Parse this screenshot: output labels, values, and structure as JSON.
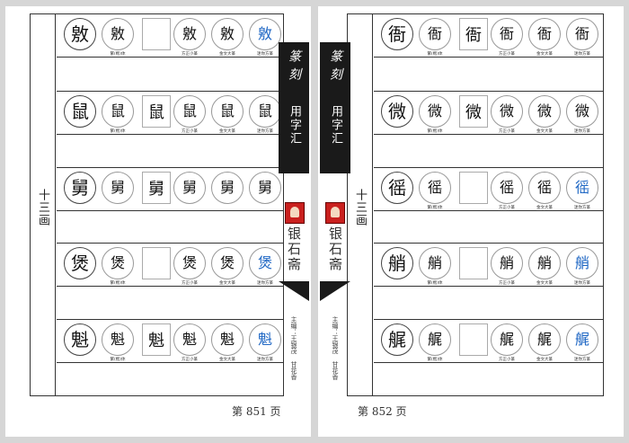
{
  "left": {
    "section": "十三画",
    "page_label": "第 851 页",
    "rows": [
      {
        "cells": [
          {
            "g": "敫",
            "k": "head"
          },
          {
            "g": "敫",
            "k": "c",
            "cap": "繁(楷)体"
          },
          {
            "g": "",
            "k": "sq"
          },
          {
            "g": "敫",
            "k": "c",
            "cap": "方正小篆"
          },
          {
            "g": "敫",
            "k": "c",
            "cap": "金文大篆"
          },
          {
            "g": "敫",
            "k": "c",
            "cap": "迷你方篆",
            "blue": true
          }
        ]
      },
      {
        "cells": [
          {
            "g": "鼠",
            "k": "head"
          },
          {
            "g": "鼠",
            "k": "c",
            "cap": "繁(楷)体"
          },
          {
            "g": "鼠",
            "k": "sq"
          },
          {
            "g": "鼠",
            "k": "c",
            "cap": "方正小篆"
          },
          {
            "g": "鼠",
            "k": "c",
            "cap": "金文大篆"
          },
          {
            "g": "鼠",
            "k": "c",
            "cap": "迷你方篆"
          }
        ]
      },
      {
        "cells": [
          {
            "g": "舅",
            "k": "head"
          },
          {
            "g": "舅",
            "k": "c",
            "cap": ""
          },
          {
            "g": "舅",
            "k": "sq"
          },
          {
            "g": "舅",
            "k": "c",
            "cap": ""
          },
          {
            "g": "舅",
            "k": "c",
            "cap": ""
          },
          {
            "g": "舅",
            "k": "c",
            "cap": ""
          }
        ]
      },
      {
        "cells": [
          {
            "g": "煲",
            "k": "head"
          },
          {
            "g": "煲",
            "k": "c",
            "cap": "繁(楷)体"
          },
          {
            "g": "",
            "k": "sq"
          },
          {
            "g": "煲",
            "k": "c",
            "cap": "方正小篆"
          },
          {
            "g": "煲",
            "k": "c",
            "cap": "金文大篆"
          },
          {
            "g": "煲",
            "k": "c",
            "cap": "迷你方篆",
            "blue": true
          }
        ]
      },
      {
        "cells": [
          {
            "g": "魁",
            "k": "head"
          },
          {
            "g": "魁",
            "k": "c",
            "cap": "繁(楷)体"
          },
          {
            "g": "魁",
            "k": "sq"
          },
          {
            "g": "魁",
            "k": "c",
            "cap": "方正小篆"
          },
          {
            "g": "魁",
            "k": "c",
            "cap": "金文大篆"
          },
          {
            "g": "魁",
            "k": "c",
            "cap": "迷你方篆",
            "blue": true
          }
        ]
      }
    ]
  },
  "right": {
    "section": "十三画",
    "page_label": "第 852 页",
    "rows": [
      {
        "cells": [
          {
            "g": "衙",
            "k": "head"
          },
          {
            "g": "衙",
            "k": "c",
            "cap": "繁(楷)体"
          },
          {
            "g": "衙",
            "k": "sq"
          },
          {
            "g": "衙",
            "k": "c",
            "cap": "方正小篆"
          },
          {
            "g": "衙",
            "k": "c",
            "cap": "金文大篆"
          },
          {
            "g": "衙",
            "k": "c",
            "cap": "迷你方篆"
          }
        ]
      },
      {
        "cells": [
          {
            "g": "微",
            "k": "head"
          },
          {
            "g": "微",
            "k": "c",
            "cap": "繁(楷)体"
          },
          {
            "g": "微",
            "k": "sq"
          },
          {
            "g": "微",
            "k": "c",
            "cap": "方正小篆"
          },
          {
            "g": "微",
            "k": "c",
            "cap": "金文大篆"
          },
          {
            "g": "微",
            "k": "c",
            "cap": "迷你方篆"
          }
        ]
      },
      {
        "cells": [
          {
            "g": "徭",
            "k": "head"
          },
          {
            "g": "徭",
            "k": "c",
            "cap": "繁(楷)体"
          },
          {
            "g": "",
            "k": "sq"
          },
          {
            "g": "徭",
            "k": "c",
            "cap": "方正小篆"
          },
          {
            "g": "徭",
            "k": "c",
            "cap": "金文大篆"
          },
          {
            "g": "徭",
            "k": "c",
            "cap": "迷你方篆",
            "blue": true
          }
        ]
      },
      {
        "cells": [
          {
            "g": "艄",
            "k": "head"
          },
          {
            "g": "艄",
            "k": "c",
            "cap": "繁(楷)体"
          },
          {
            "g": "",
            "k": "sq"
          },
          {
            "g": "艄",
            "k": "c",
            "cap": "方正小篆"
          },
          {
            "g": "艄",
            "k": "c",
            "cap": "金文大篆"
          },
          {
            "g": "艄",
            "k": "c",
            "cap": "迷你方篆",
            "blue": true
          }
        ]
      },
      {
        "cells": [
          {
            "g": "艉",
            "k": "head"
          },
          {
            "g": "艉",
            "k": "c",
            "cap": "繁(楷)体"
          },
          {
            "g": "",
            "k": "sq"
          },
          {
            "g": "艉",
            "k": "c",
            "cap": "方正小篆"
          },
          {
            "g": "艉",
            "k": "c",
            "cap": "金文大篆"
          },
          {
            "g": "艉",
            "k": "c",
            "cap": "迷你方篆",
            "blue": true
          }
        ]
      }
    ]
  },
  "spine": {
    "title": "篆刻",
    "subtitle": "用字汇",
    "studio": "银石斋",
    "editors": "主编：王银茂 甘花香"
  },
  "colors": {
    "accent_blue": "#1f67c4",
    "seal_red": "#c9201e"
  }
}
